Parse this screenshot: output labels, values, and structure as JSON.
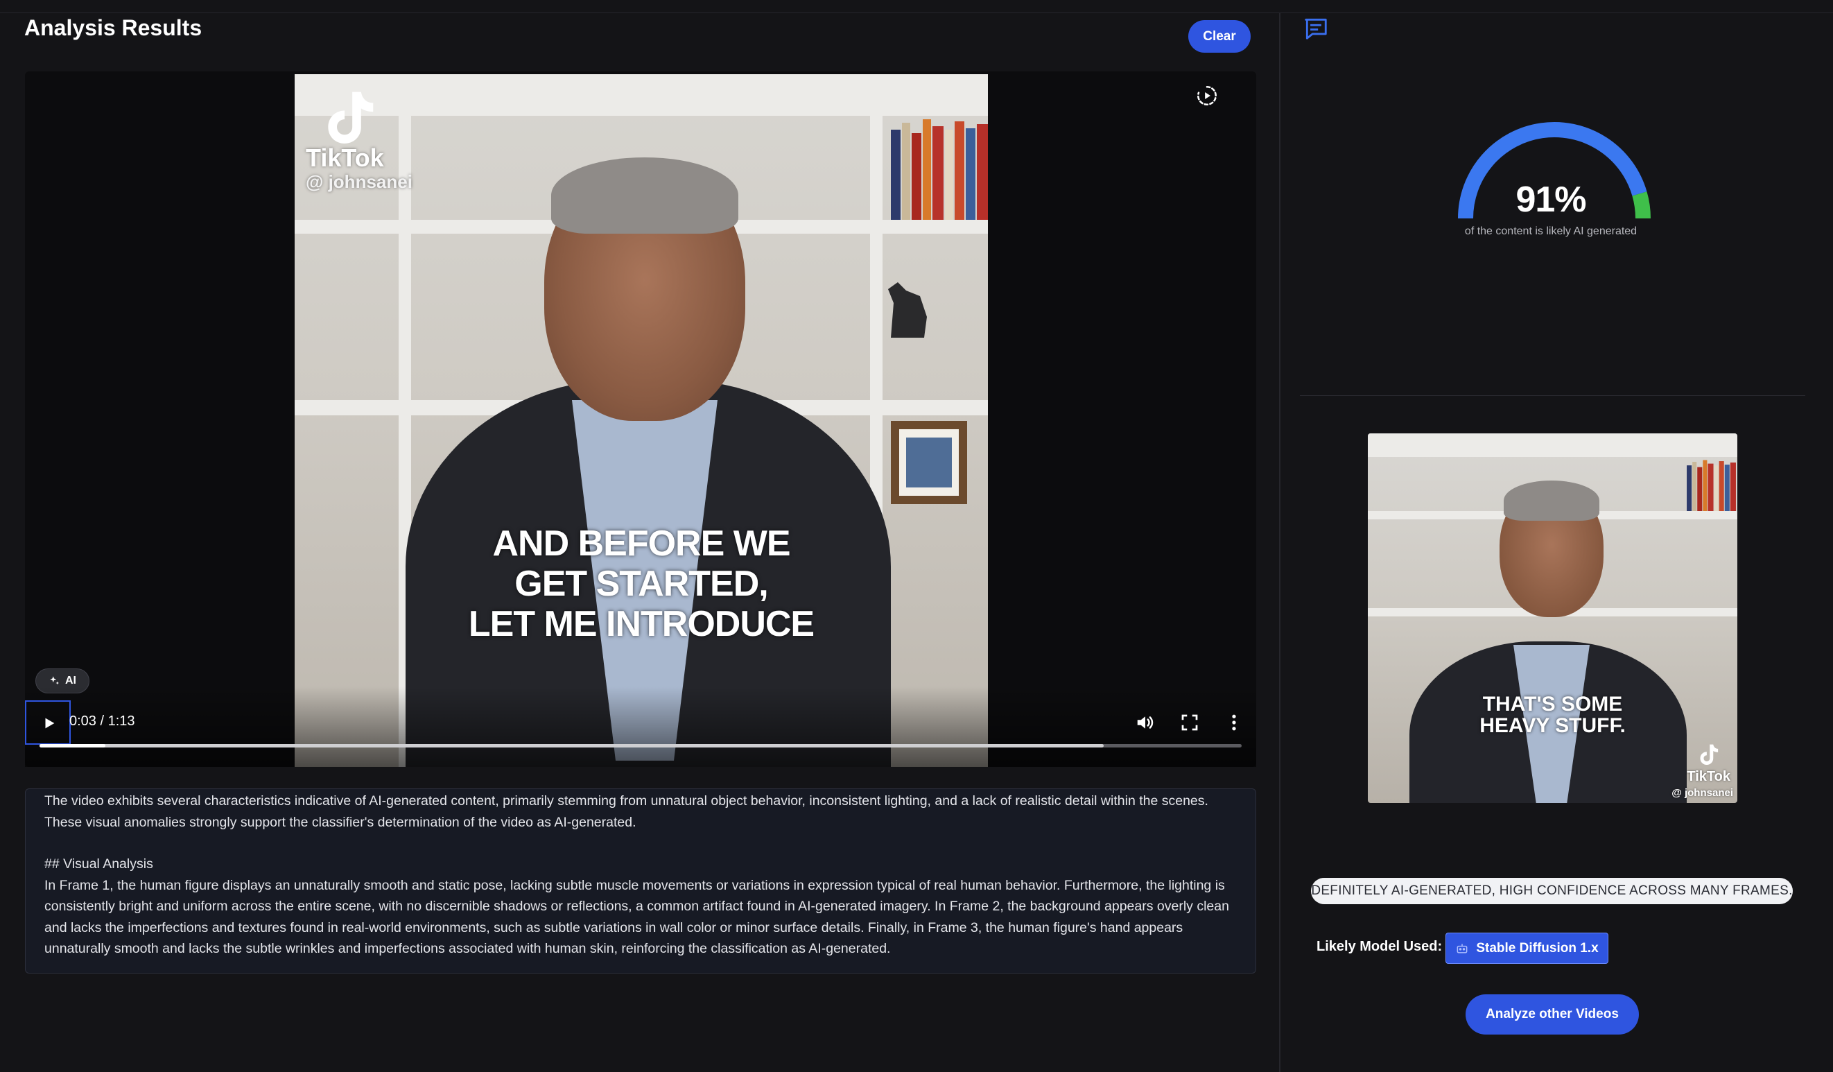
{
  "header": {
    "title": "Analysis Results",
    "clear_label": "Clear"
  },
  "video": {
    "caption_lines": [
      "AND BEFORE WE",
      "GET STARTED,",
      "LET ME INTRODUCE"
    ],
    "watermark_brand": "TikTok",
    "watermark_handle": "@ johnsanei",
    "ai_badge": "AI",
    "time": "0:03 / 1:13",
    "played_fraction": 0.055,
    "buffered_fraction": 0.885
  },
  "analysis": {
    "summary": "The video exhibits several characteristics indicative of AI-generated content, primarily stemming from unnatural object behavior, inconsistent lighting, and a lack of realistic detail within the scenes. These visual anomalies strongly support the classifier's determination of the video as AI-generated.",
    "section_heading": "## Visual Analysis",
    "details": "In Frame 1, the human figure displays an unnaturally smooth and static pose, lacking subtle muscle movements or variations in expression typical of real human behavior. Furthermore, the lighting is consistently bright and uniform across the entire scene, with no discernible shadows or reflections, a common artifact found in AI-generated imagery. In Frame 2, the background appears overly clean and lacks the imperfections and textures found in real-world environments, such as subtle variations in wall color or minor surface details. Finally, in Frame 3, the human figure's hand appears unnaturally smooth and lacks the subtle wrinkles and imperfections associated with human skin, reinforcing the classification as AI-generated."
  },
  "score": {
    "value_text": "91%",
    "value_fraction": 0.91,
    "label": "of the content is likely AI generated",
    "colors": {
      "fill": "#3b78f0",
      "remainder": "#3fbf4a"
    }
  },
  "thumbnail": {
    "caption_lines": [
      "THAT'S SOME",
      "HEAVY STUFF."
    ],
    "watermark_brand": "TikTok",
    "watermark_handle": "@ johnsanei"
  },
  "verdict": {
    "text": "DEFINITELY AI-GENERATED, HIGH CONFIDENCE ACROSS MANY FRAMES."
  },
  "model": {
    "label": "Likely Model Used:",
    "name": "Stable Diffusion 1.x"
  },
  "actions": {
    "analyze_other_label": "Analyze other Videos"
  },
  "icons": {
    "chat": "chat-icon",
    "replay": "replay-icon",
    "play": "play-icon",
    "volume": "volume-icon",
    "fullscreen": "fullscreen-icon",
    "more": "more-options-icon",
    "sparkle": "sparkle-icon",
    "robot": "robot-icon"
  }
}
